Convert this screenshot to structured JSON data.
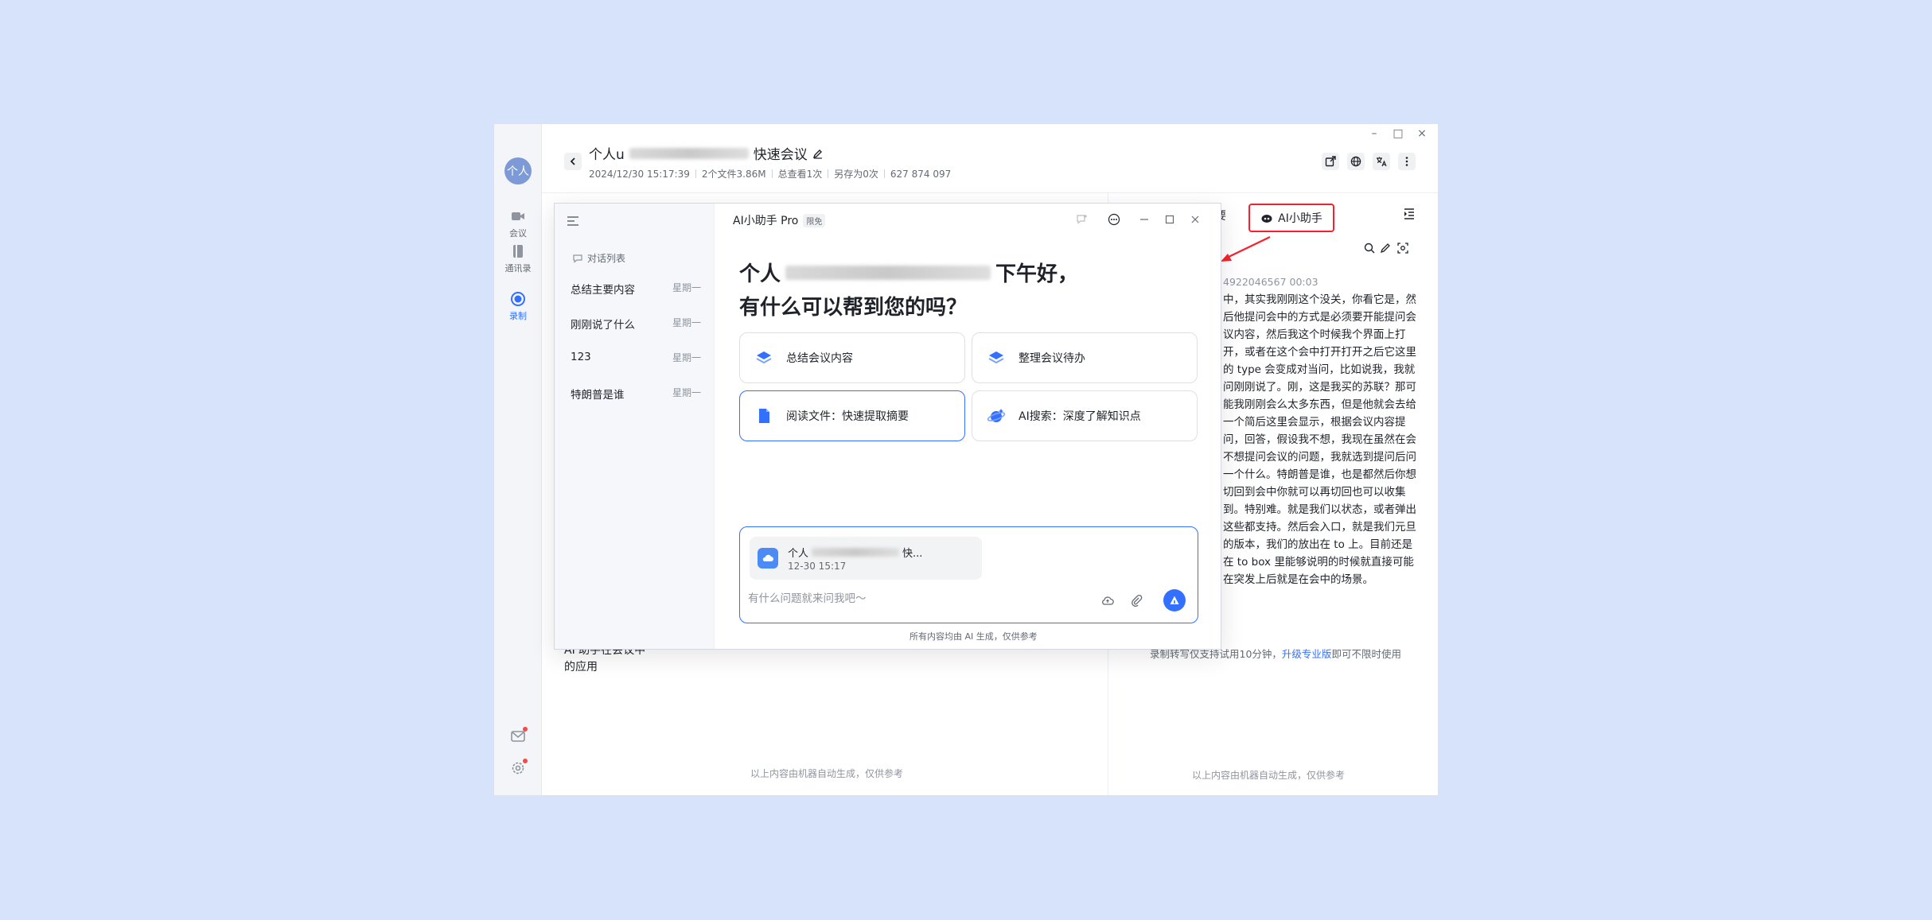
{
  "app": {
    "avatar_label": "个人",
    "rail": {
      "meeting": "会议",
      "contacts": "通讯录",
      "recording": "录制"
    },
    "header": {
      "title_prefix": "个人u",
      "title_suffix": "快速会议",
      "meta": [
        "2024/12/30 15:17:39",
        "2个文件3.86M",
        "总查看1次",
        "另存为0次",
        "627 874 097"
      ]
    },
    "transcript_heading": "AI 助手在会议中的应用",
    "footnote": "以上内容由机器自动生成，仅供参考",
    "right_panel": {
      "partial_tab": "要",
      "ai_tab_label": "AI小助手",
      "timestamp": "4922046567 00:03",
      "transcript": "中，其实我刚刚这个没关，你看它是，然后他提问会中的方式是必须要开能提问会议内容，然后我这个时候我个界面上打开，或者在这个会中打开打开之后它这里的 type 会变成对当问，比如说我，我就问刚刚说了。刚，这是我买的苏联？那可能我刚刚会么太多东西，但是他就会去给一个简后这里会显示，根据会议内容提问，回答，假设我不想，我现在虽然在会不想提问会议的问题，我就选到提问后问一个什么。特朗普是谁，也是都然后你想切回到会中你就可以再切回也可以收集到。特别难。就是我们以状态，或者弹出这些都支持。然后会入口，就是我们元旦的版本，我们的放出在 to 上。目前还是在 to box 里能够说明的时候就直接可能在突发上后就是在会中的场景。",
      "upgrade_prefix": "录制转写仅支持试用10分钟，",
      "upgrade_link": "升级专业版",
      "upgrade_suffix": "即可不限时使用",
      "footnote": "以上内容由机器自动生成，仅供参考"
    }
  },
  "popup": {
    "title": "AI小助手 Pro",
    "badge": "限免",
    "conversation_list_label": "对话列表",
    "conversations": [
      {
        "title": "总结主要内容",
        "date": "星期一"
      },
      {
        "title": "刚刚说了什么",
        "date": "星期一"
      },
      {
        "title": "123",
        "date": "星期一"
      },
      {
        "title": "特朗普是谁",
        "date": "星期一"
      }
    ],
    "greeting_prefix": "个人",
    "greeting_suffix": "下午好，",
    "greeting_line2": "有什么可以帮到您的吗？",
    "cards": [
      {
        "label": "总结会议内容"
      },
      {
        "label": "整理会议待办"
      },
      {
        "label": "阅读文件：快速提取摘要"
      },
      {
        "label": "AI搜索：深度了解知识点"
      }
    ],
    "file_chip": {
      "name_prefix": "个人",
      "name_suffix": "快...",
      "date": "12-30 15:17"
    },
    "input_placeholder": "有什么问题就来问我吧～",
    "footnote": "所有内容均由 AI 生成，仅供参考"
  },
  "colors": {
    "accent": "#3370ff",
    "highlight_border": "#f5222d",
    "background": "#d6e3fb"
  }
}
